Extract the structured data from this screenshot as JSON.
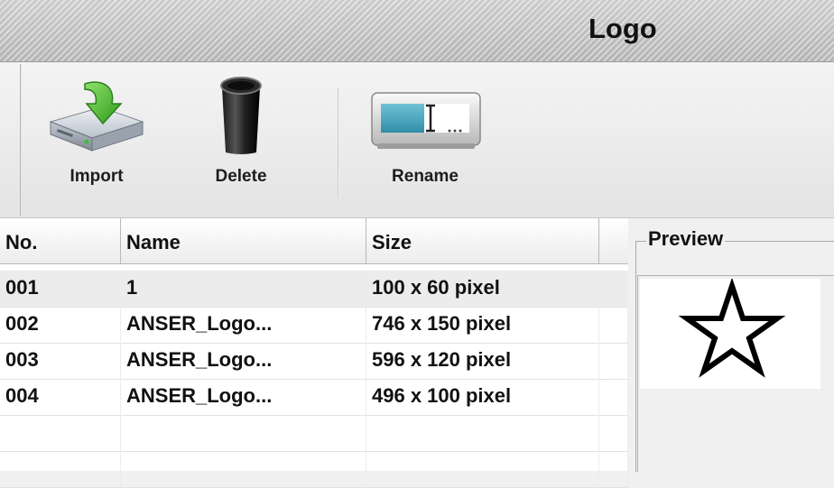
{
  "window": {
    "title": "Logo"
  },
  "toolbar": {
    "import_label": "Import",
    "delete_label": "Delete",
    "rename_label": "Rename"
  },
  "table": {
    "headers": {
      "no": "No.",
      "name": "Name",
      "size": "Size"
    },
    "rows": [
      {
        "no": "001",
        "name": "1",
        "size": "100 x 60 pixel"
      },
      {
        "no": "002",
        "name": "ANSER_Logo...",
        "size": "746 x 150 pixel"
      },
      {
        "no": "003",
        "name": "ANSER_Logo...",
        "size": "596 x 120 pixel"
      },
      {
        "no": "004",
        "name": "ANSER_Logo...",
        "size": "496 x 100 pixel"
      }
    ],
    "selected_row": 0
  },
  "preview": {
    "label": "Preview",
    "shape": "star-outline"
  },
  "icons": {
    "import": "drive-download-icon",
    "delete": "trash-bin-icon",
    "rename": "text-field-icon"
  }
}
